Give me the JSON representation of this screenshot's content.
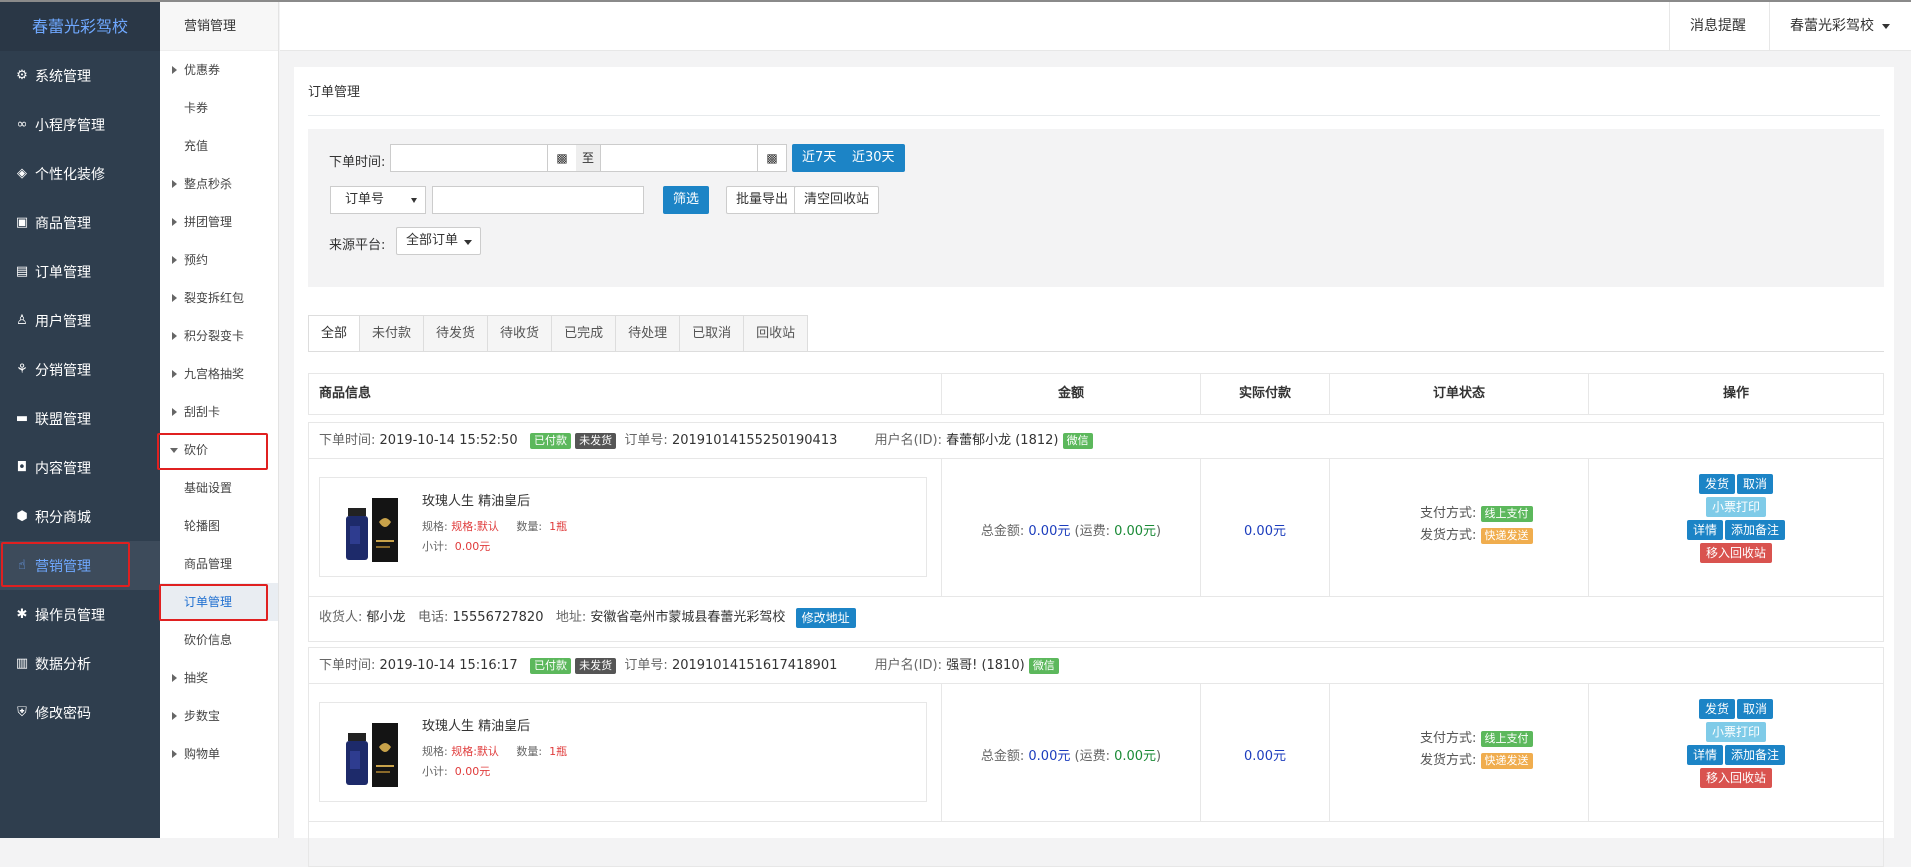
{
  "sidebar": {
    "brand": "春蕾光彩驾校",
    "items": [
      {
        "label": "系统管理",
        "icon": "gear-icon",
        "glyph": "⚙"
      },
      {
        "label": "小程序管理",
        "icon": "link-icon",
        "glyph": "∞"
      },
      {
        "label": "个性化装修",
        "icon": "layers-icon",
        "glyph": "◈"
      },
      {
        "label": "商品管理",
        "icon": "shop-icon",
        "glyph": "▣"
      },
      {
        "label": "订单管理",
        "icon": "list-icon",
        "glyph": "▤"
      },
      {
        "label": "用户管理",
        "icon": "user-icon",
        "glyph": "♙"
      },
      {
        "label": "分销管理",
        "icon": "sitemap-icon",
        "glyph": "⚘"
      },
      {
        "label": "联盟管理",
        "icon": "store-icon",
        "glyph": "▬"
      },
      {
        "label": "内容管理",
        "icon": "content-icon",
        "glyph": "◘"
      },
      {
        "label": "积分商城",
        "icon": "cube-icon",
        "glyph": "⬢"
      },
      {
        "label": "营销管理",
        "icon": "marketing-icon",
        "glyph": "☝"
      },
      {
        "label": "操作员管理",
        "icon": "cog-icon",
        "glyph": "✱"
      },
      {
        "label": "数据分析",
        "icon": "chart-icon",
        "glyph": "▥"
      },
      {
        "label": "修改密码",
        "icon": "shield-icon",
        "glyph": "⛨"
      }
    ]
  },
  "submenu": {
    "head": "营销管理",
    "rows": [
      {
        "label": "优惠券",
        "type": "arrow"
      },
      {
        "label": "卡券",
        "type": "plain"
      },
      {
        "label": "充值",
        "type": "plain"
      },
      {
        "label": "整点秒杀",
        "type": "arrow"
      },
      {
        "label": "拼团管理",
        "type": "arrow"
      },
      {
        "label": "预约",
        "type": "arrow"
      },
      {
        "label": "裂变拆红包",
        "type": "arrow"
      },
      {
        "label": "积分裂变卡",
        "type": "arrow"
      },
      {
        "label": "九宫格抽奖",
        "type": "arrow"
      },
      {
        "label": "刮刮卡",
        "type": "arrow"
      },
      {
        "label": "砍价",
        "type": "open"
      },
      {
        "label": "基础设置",
        "type": "plain"
      },
      {
        "label": "轮播图",
        "type": "plain"
      },
      {
        "label": "商品管理",
        "type": "plain"
      },
      {
        "label": "订单管理",
        "type": "current"
      },
      {
        "label": "砍价信息",
        "type": "plain"
      },
      {
        "label": "抽奖",
        "type": "arrow"
      },
      {
        "label": "步数宝",
        "type": "arrow"
      },
      {
        "label": "购物单",
        "type": "arrow"
      }
    ]
  },
  "topbar": {
    "notice": "消息提醒",
    "account": "春蕾光彩驾校"
  },
  "panel": {
    "title": "订单管理",
    "filter": {
      "time_label": "下单时间:",
      "to": "至",
      "btn_7": "近7天",
      "btn_30": "近30天",
      "search_type": "订单号",
      "btn_filter": "筛选",
      "btn_export": "批量导出",
      "btn_clear": "清空回收站",
      "source_label": "来源平台:",
      "source_value": "全部订单"
    },
    "tabs": [
      "全部",
      "未付款",
      "待发货",
      "待收货",
      "已完成",
      "待处理",
      "已取消",
      "回收站"
    ],
    "columns": [
      "商品信息",
      "金额",
      "实际付款",
      "订单状态",
      "操作"
    ]
  },
  "orders": [
    {
      "time_label": "下单时间:",
      "time": "2019-10-14 15:52:50",
      "paid": "已付款",
      "ship": "未发货",
      "no_label": "订单号:",
      "no": "20191014155250190413",
      "user_label": "用户名(ID):",
      "user": "春蕾郁小龙 (1812)",
      "platform": "微信",
      "goods_name": "玫瑰人生 精油皇后",
      "spec_label": "规格:",
      "spec": "规格:默认",
      "qty_label": "数量:",
      "qty": "1瓶",
      "subtotal_label": "小计:",
      "subtotal": "0.00元",
      "total_label": "总金额:",
      "total": "0.00元",
      "freight_pre": "(运费:",
      "freight": "0.00元",
      "freight_post": ")",
      "actual": "0.00元",
      "pay_label": "支付方式:",
      "pay": "线上支付",
      "deliver_label": "发货方式:",
      "deliver": "快递发送",
      "ops": [
        "发货",
        "取消",
        "小票打印",
        "详情",
        "添加备注",
        "移入回收站"
      ],
      "receiver_label": "收货人:",
      "receiver": "郁小龙",
      "phone_label": "电话:",
      "phone": "15556727820",
      "addr_label": "地址:",
      "addr": "安徽省亳州市蒙城县春蕾光彩驾校",
      "modify": "修改地址"
    },
    {
      "time_label": "下单时间:",
      "time": "2019-10-14 15:16:17",
      "paid": "已付款",
      "ship": "未发货",
      "no_label": "订单号:",
      "no": "20191014151617418901",
      "user_label": "用户名(ID):",
      "user": "强哥! (1810)",
      "platform": "微信",
      "goods_name": "玫瑰人生 精油皇后",
      "spec_label": "规格:",
      "spec": "规格:默认",
      "qty_label": "数量:",
      "qty": "1瓶",
      "subtotal_label": "小计:",
      "subtotal": "0.00元",
      "total_label": "总金额:",
      "total": "0.00元",
      "freight_pre": "(运费:",
      "freight": "0.00元",
      "freight_post": ")",
      "actual": "0.00元",
      "pay_label": "支付方式:",
      "pay": "线上支付",
      "deliver_label": "发货方式:",
      "deliver": "快递发送",
      "ops": [
        "发货",
        "取消",
        "小票打印",
        "详情",
        "添加备注",
        "移入回收站"
      ]
    }
  ]
}
